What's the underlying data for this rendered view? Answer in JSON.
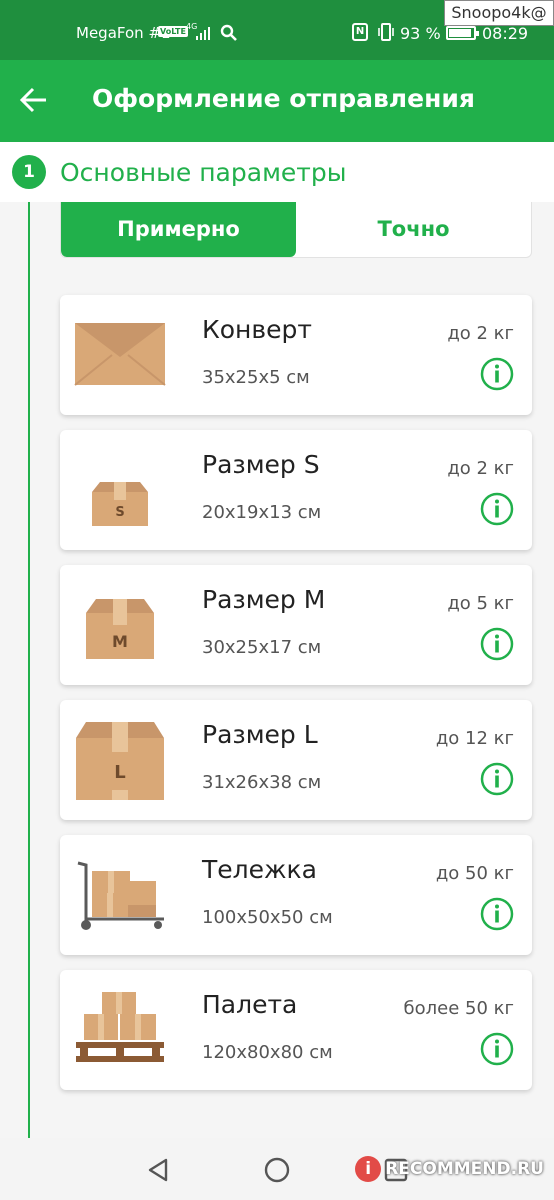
{
  "status_bar": {
    "carrier": "MegaFon #1",
    "volte": "VoLTE",
    "network": "4G",
    "battery_percent": "93 %",
    "time": "08:29",
    "watermark": "Snoopo4k@"
  },
  "app_bar": {
    "title": "Оформление отправления",
    "back_icon": "arrow-back-icon"
  },
  "section": {
    "number": "1",
    "title": "Основные параметры"
  },
  "mode_tabs": [
    {
      "label": "Примерно",
      "selected": true
    },
    {
      "label": "Точно",
      "selected": false
    }
  ],
  "packages": [
    {
      "name": "Конверт",
      "dims": "35x25x5 см",
      "weight": "до 2 кг",
      "icon": "envelope-icon"
    },
    {
      "name": "Размер S",
      "dims": "20x19x13 см",
      "weight": "до 2 кг",
      "icon": "box-s-icon",
      "letter": "S"
    },
    {
      "name": "Размер M",
      "dims": "30x25x17 см",
      "weight": "до 5 кг",
      "icon": "box-m-icon",
      "letter": "M"
    },
    {
      "name": "Размер L",
      "dims": "31x26x38 см",
      "weight": "до 12 кг",
      "icon": "box-l-icon",
      "letter": "L"
    },
    {
      "name": "Тележка",
      "dims": "100x50x50 см",
      "weight": "до 50 кг",
      "icon": "cart-icon"
    },
    {
      "name": "Палета",
      "dims": "120x80x80 см",
      "weight": "более 50 кг",
      "icon": "pallet-icon"
    }
  ],
  "nav_bar": {
    "brand": "RECOMMEND.RU",
    "brand_logo": "i"
  },
  "colors": {
    "primary": "#21b04b",
    "status_bar": "#1f8f3e",
    "box": "#d9a877"
  }
}
